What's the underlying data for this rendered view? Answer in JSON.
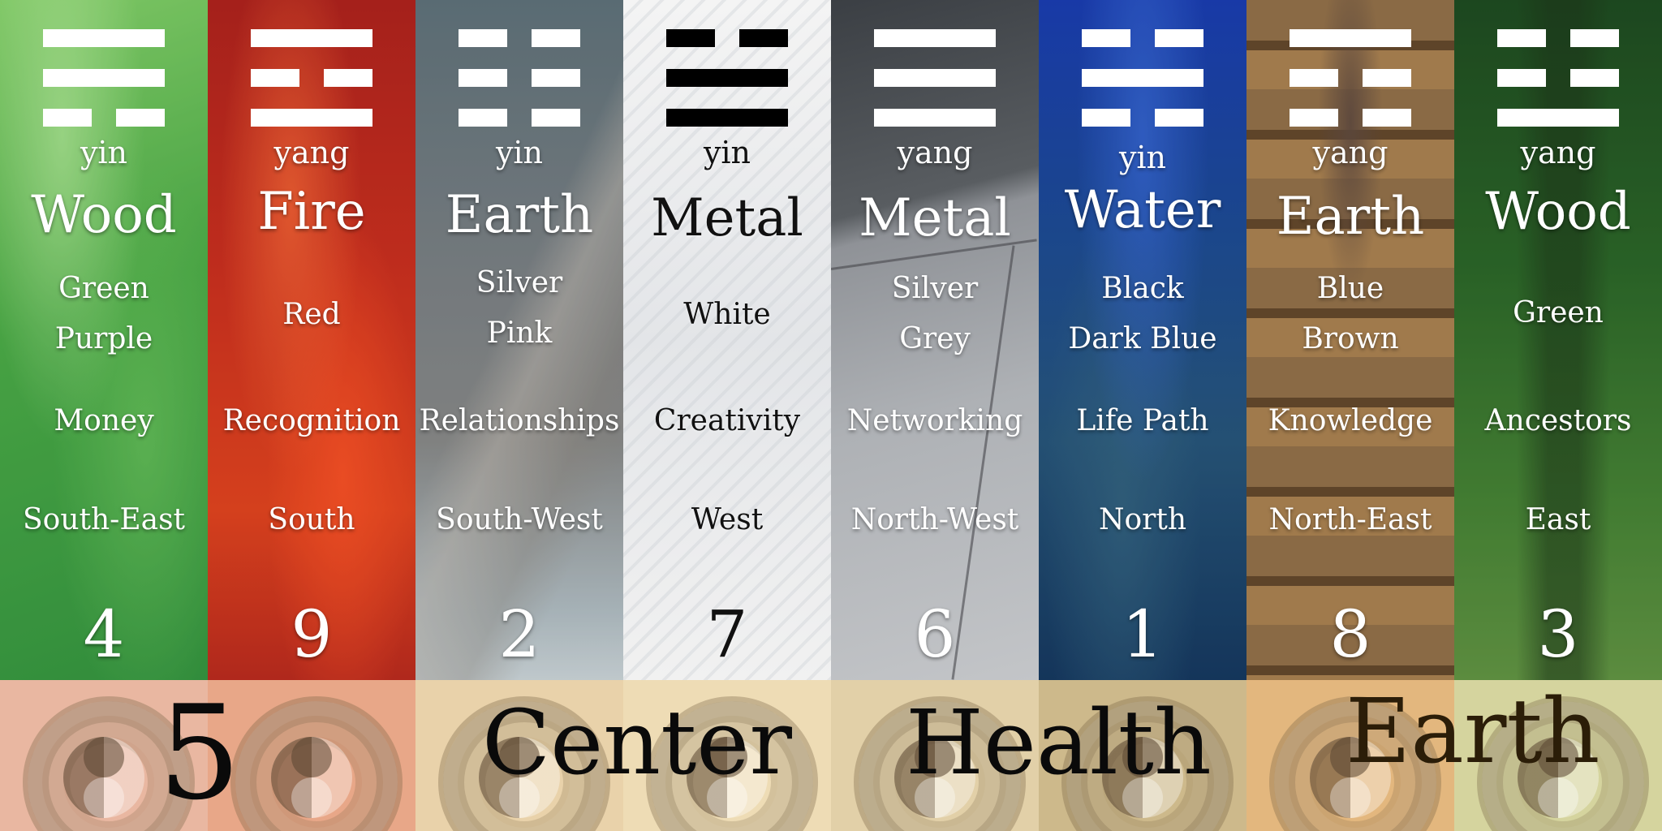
{
  "columns": [
    {
      "polarity": "yin",
      "element": "Wood",
      "colors": [
        "Green",
        "Purple"
      ],
      "aspiration": "Money",
      "direction": "South-East",
      "number": "4",
      "trigram": [
        "solid",
        "solid",
        "broken"
      ],
      "theme": "light"
    },
    {
      "polarity": "yang",
      "element": "Fire",
      "colors": [
        "Red"
      ],
      "aspiration": "Recognition",
      "direction": "South",
      "number": "9",
      "trigram": [
        "solid",
        "broken",
        "solid"
      ],
      "theme": "light"
    },
    {
      "polarity": "yin",
      "element": "Earth",
      "colors": [
        "Silver",
        "Pink"
      ],
      "aspiration": "Relationships",
      "direction": "South-West",
      "number": "2",
      "trigram": [
        "broken",
        "broken",
        "broken"
      ],
      "theme": "light"
    },
    {
      "polarity": "yin",
      "element": "Metal",
      "colors": [
        "White"
      ],
      "aspiration": "Creativity",
      "direction": "West",
      "number": "7",
      "trigram": [
        "broken",
        "solid",
        "solid"
      ],
      "theme": "dark"
    },
    {
      "polarity": "yang",
      "element": "Metal",
      "colors": [
        "Silver",
        "Grey"
      ],
      "aspiration": "Networking",
      "direction": "North-West",
      "number": "6",
      "trigram": [
        "solid",
        "solid",
        "solid"
      ],
      "theme": "light"
    },
    {
      "polarity": "yin",
      "element": "Water",
      "colors": [
        "Black",
        "Dark Blue"
      ],
      "aspiration": "Life Path",
      "direction": "North",
      "number": "1",
      "trigram": [
        "broken",
        "solid",
        "broken"
      ],
      "theme": "light"
    },
    {
      "polarity": "yang",
      "element": "Earth",
      "colors": [
        "Blue",
        "Brown"
      ],
      "aspiration": "Knowledge",
      "direction": "North-East",
      "number": "8",
      "trigram": [
        "solid",
        "broken",
        "broken"
      ],
      "theme": "light"
    },
    {
      "polarity": "yang",
      "element": "Wood",
      "colors": [
        "Green"
      ],
      "aspiration": "Ancestors",
      "direction": "East",
      "number": "3",
      "trigram": [
        "broken",
        "broken",
        "solid"
      ],
      "theme": "light"
    }
  ],
  "center": {
    "number": "5",
    "label": "Center",
    "aspiration": "Health",
    "element": "Earth"
  }
}
